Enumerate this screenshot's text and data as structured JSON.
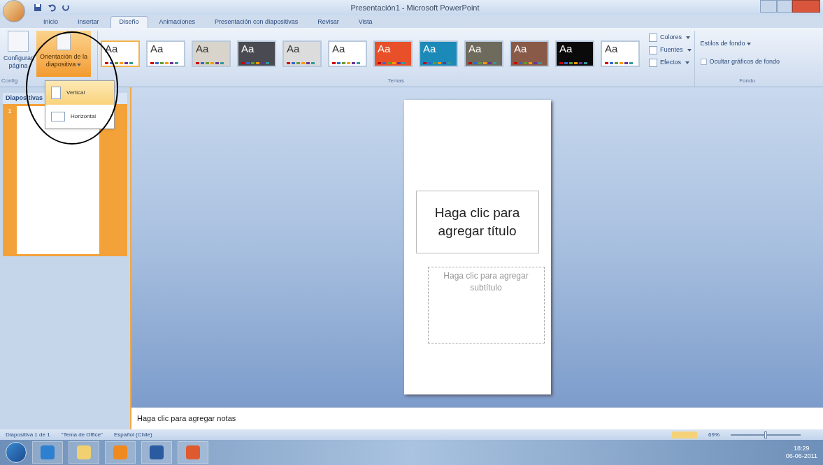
{
  "window": {
    "title": "Presentación1 - Microsoft PowerPoint"
  },
  "tabs": [
    {
      "label": "Inicio",
      "selected": false
    },
    {
      "label": "Insertar",
      "selected": false
    },
    {
      "label": "Diseño",
      "selected": true
    },
    {
      "label": "Animaciones",
      "selected": false
    },
    {
      "label": "Presentación con diapositivas",
      "selected": false
    },
    {
      "label": "Revisar",
      "selected": false
    },
    {
      "label": "Vista",
      "selected": false
    }
  ],
  "page_setup_group": {
    "page_setup": "Configurar página",
    "orientation": "Orientación de la diapositiva",
    "orientation_selected": true,
    "label": "Config"
  },
  "orientation_menu": [
    {
      "label": "Vertical",
      "selected": true
    },
    {
      "label": "Horizontal",
      "selected": false
    }
  ],
  "themes_group": {
    "label": "Temas",
    "themes": [
      {
        "label": "Aa",
        "color": "#ffffff",
        "selected": true
      },
      {
        "label": "Aa",
        "color": "#ffffff",
        "selected": false
      },
      {
        "label": "Aa",
        "color": "#d8d4cc",
        "selected": false
      },
      {
        "label": "Aa",
        "color": "#4a4a52",
        "selected": false
      },
      {
        "label": "Aa",
        "color": "#dcdcdc",
        "selected": false
      },
      {
        "label": "Aa",
        "color": "#ffffff",
        "selected": false
      },
      {
        "label": "Aa",
        "color": "#e8502a",
        "selected": false
      },
      {
        "label": "Aa",
        "color": "#1c8ab8",
        "selected": false
      },
      {
        "label": "Aa",
        "color": "#6e6a5c",
        "selected": false
      },
      {
        "label": "Aa",
        "color": "#8a5a48",
        "selected": false
      },
      {
        "label": "Aa",
        "color": "#0a0a0a",
        "selected": false
      },
      {
        "label": "Aa",
        "color": "#ffffff",
        "selected": false
      }
    ],
    "options": [
      "Colores",
      "Fuentes",
      "Efectos"
    ]
  },
  "background_group": {
    "label": "Fondo",
    "styles": "Estilos de fondo",
    "hide_graphics": "Ocultar gráficos de fondo",
    "hide_checked": false
  },
  "slides_panel": {
    "tab": "Diapositivas",
    "slide_number": "1"
  },
  "slide": {
    "title": "Haga clic para agregar título",
    "subtitle": "Haga clic para agregar subtítulo"
  },
  "notes": {
    "placeholder": "Haga clic para agregar notas"
  },
  "status_bar": {
    "slide": "Diapositiva 1 de 1",
    "theme": "\"Tema de Office\"",
    "language": "Español (Chile)",
    "zoom": "69%",
    "zoom_slider": {
      "level": 0.5
    }
  },
  "taskbar": {
    "time": "18:29",
    "date": "06-06-2011"
  }
}
